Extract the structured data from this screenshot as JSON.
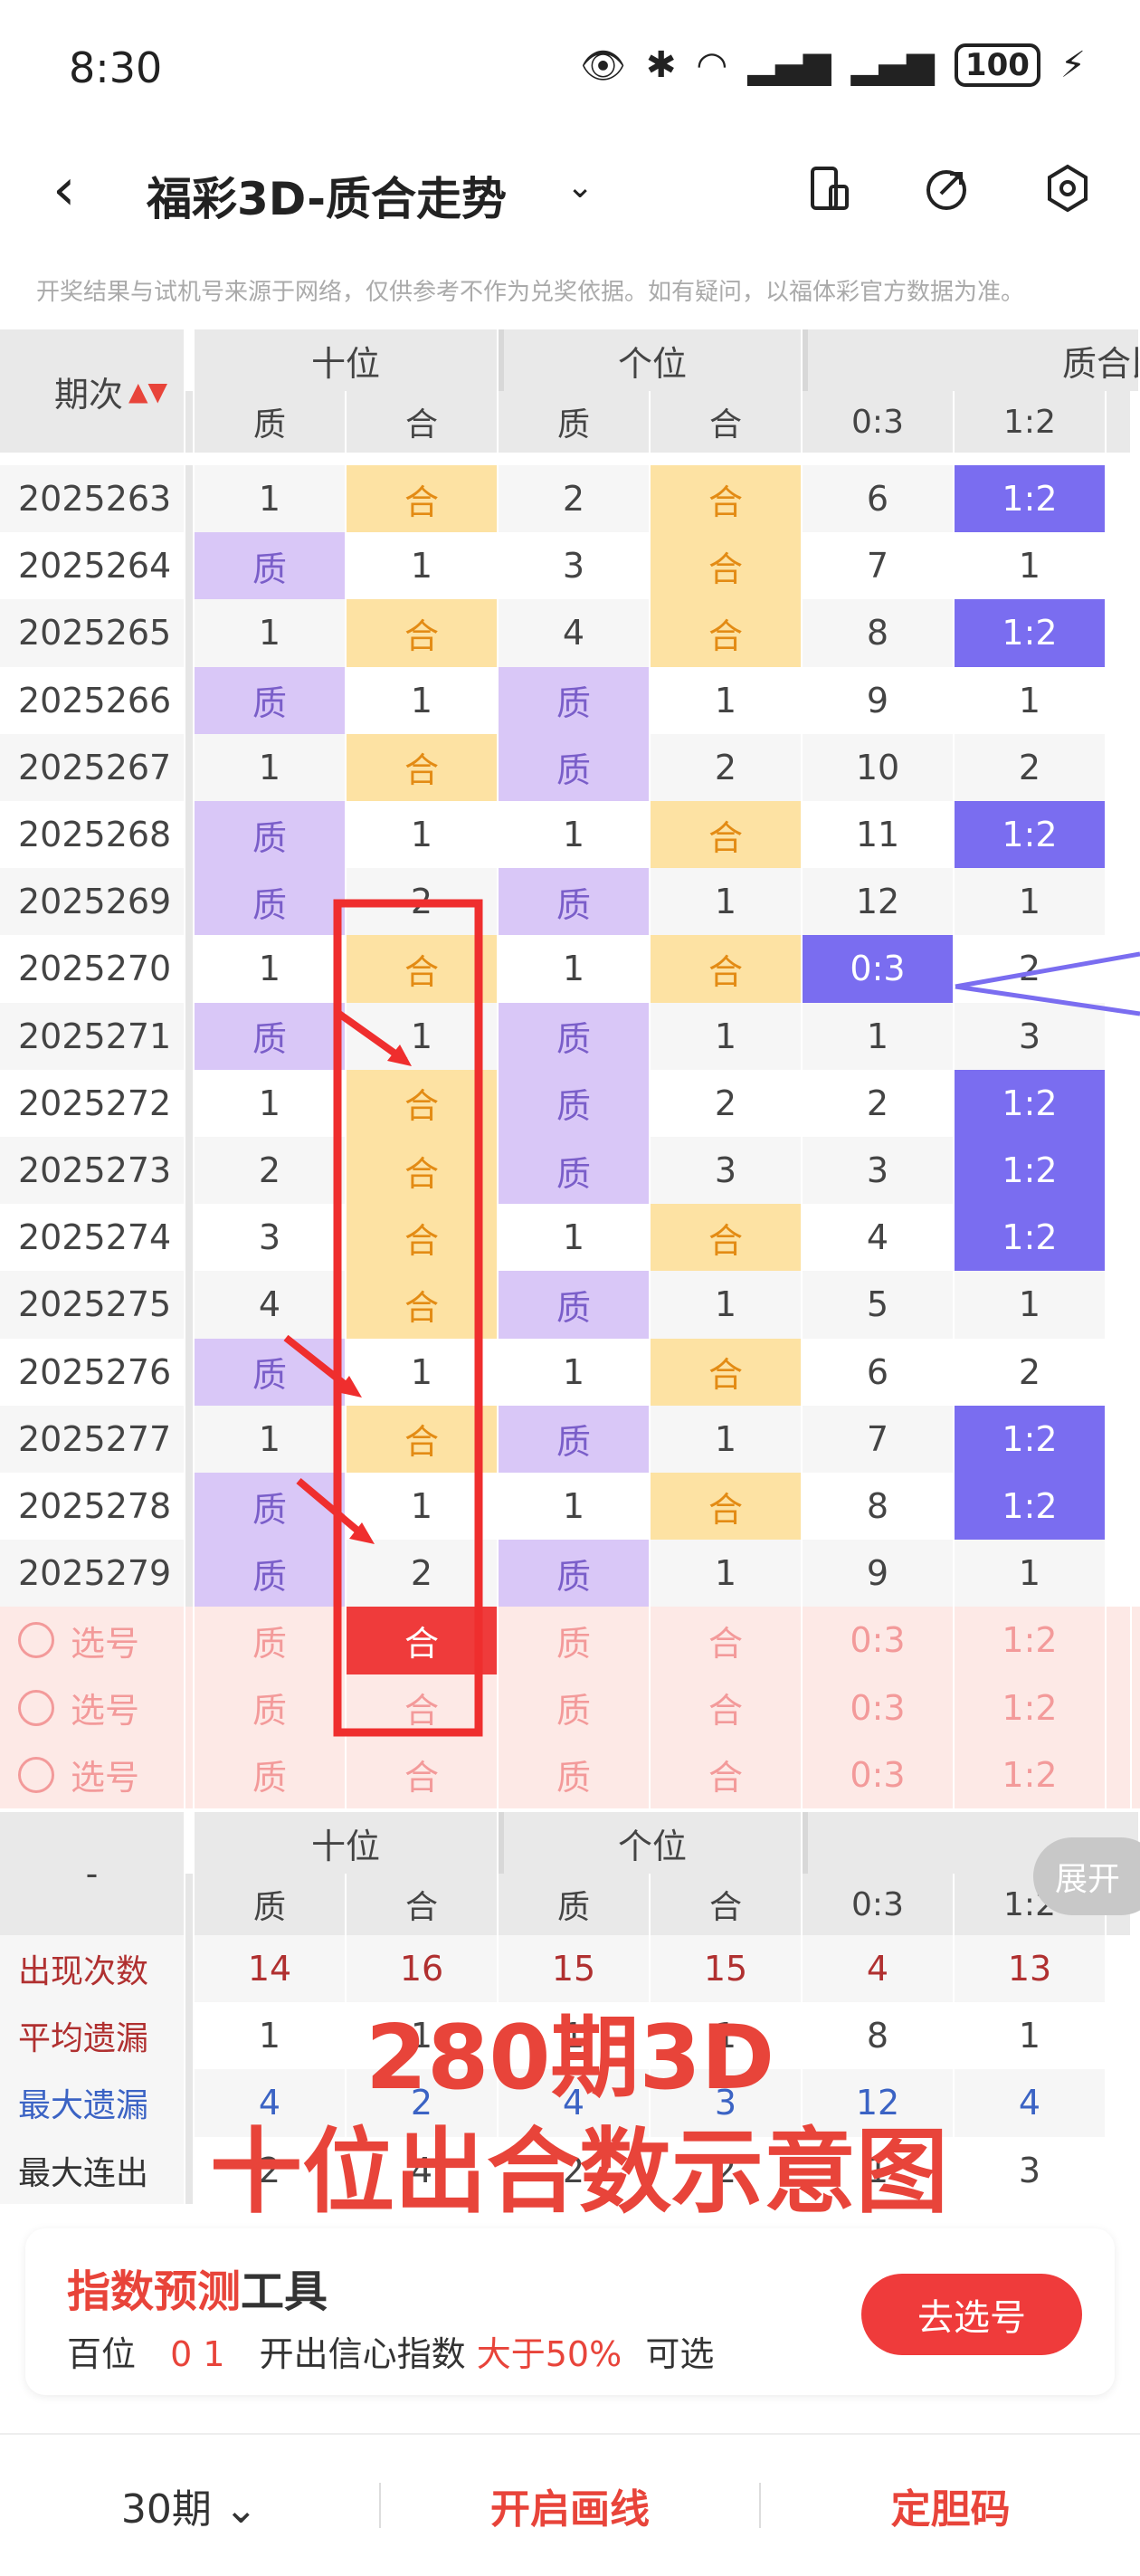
{
  "status": {
    "time": "8:30",
    "battery": "100"
  },
  "header": {
    "title": "福彩3D-质合走势"
  },
  "notice": "开奖结果与试机号来源于网络，仅供参考不作为兑奖依据。如有疑问，以福体彩官方数据为准。",
  "table": {
    "col_period": "期次",
    "group_shi": "十位",
    "group_ge": "个位",
    "group_ratio": "质合比",
    "sub_zhi": "质",
    "sub_he": "合",
    "ratio_03": "0:3",
    "ratio_12": "1:2",
    "rows": [
      {
        "period": "2025263",
        "shi_zhi": "1",
        "shi_he": "合",
        "ge_zhi": "2",
        "ge_he": "合",
        "r03": "6",
        "r12": "1:2"
      },
      {
        "period": "2025264",
        "shi_zhi": "质",
        "shi_he": "1",
        "ge_zhi": "3",
        "ge_he": "合",
        "r03": "7",
        "r12": "1"
      },
      {
        "period": "2025265",
        "shi_zhi": "1",
        "shi_he": "合",
        "ge_zhi": "4",
        "ge_he": "合",
        "r03": "8",
        "r12": "1:2"
      },
      {
        "period": "2025266",
        "shi_zhi": "质",
        "shi_he": "1",
        "ge_zhi": "质",
        "ge_he": "1",
        "r03": "9",
        "r12": "1"
      },
      {
        "period": "2025267",
        "shi_zhi": "1",
        "shi_he": "合",
        "ge_zhi": "质",
        "ge_he": "2",
        "r03": "10",
        "r12": "2"
      },
      {
        "period": "2025268",
        "shi_zhi": "质",
        "shi_he": "1",
        "ge_zhi": "1",
        "ge_he": "合",
        "r03": "11",
        "r12": "1:2"
      },
      {
        "period": "2025269",
        "shi_zhi": "质",
        "shi_he": "2",
        "ge_zhi": "质",
        "ge_he": "1",
        "r03": "12",
        "r12": "1"
      },
      {
        "period": "2025270",
        "shi_zhi": "1",
        "shi_he": "合",
        "ge_zhi": "1",
        "ge_he": "合",
        "r03": "0:3",
        "r12": "2"
      },
      {
        "period": "2025271",
        "shi_zhi": "质",
        "shi_he": "1",
        "ge_zhi": "质",
        "ge_he": "1",
        "r03": "1",
        "r12": "3"
      },
      {
        "period": "2025272",
        "shi_zhi": "1",
        "shi_he": "合",
        "ge_zhi": "质",
        "ge_he": "2",
        "r03": "2",
        "r12": "1:2"
      },
      {
        "period": "2025273",
        "shi_zhi": "2",
        "shi_he": "合",
        "ge_zhi": "质",
        "ge_he": "3",
        "r03": "3",
        "r12": "1:2"
      },
      {
        "period": "2025274",
        "shi_zhi": "3",
        "shi_he": "合",
        "ge_zhi": "1",
        "ge_he": "合",
        "r03": "4",
        "r12": "1:2"
      },
      {
        "period": "2025275",
        "shi_zhi": "4",
        "shi_he": "合",
        "ge_zhi": "质",
        "ge_he": "1",
        "r03": "5",
        "r12": "1"
      },
      {
        "period": "2025276",
        "shi_zhi": "质",
        "shi_he": "1",
        "ge_zhi": "1",
        "ge_he": "合",
        "r03": "6",
        "r12": "2"
      },
      {
        "period": "2025277",
        "shi_zhi": "1",
        "shi_he": "合",
        "ge_zhi": "质",
        "ge_he": "1",
        "r03": "7",
        "r12": "1:2"
      },
      {
        "period": "2025278",
        "shi_zhi": "质",
        "shi_he": "1",
        "ge_zhi": "1",
        "ge_he": "合",
        "r03": "8",
        "r12": "1:2"
      },
      {
        "period": "2025279",
        "shi_zhi": "质",
        "shi_he": "2",
        "ge_zhi": "质",
        "ge_he": "1",
        "r03": "9",
        "r12": "1"
      }
    ],
    "select_label": "选号",
    "select_rows": [
      {
        "shi_zhi": "质",
        "shi_he": "合",
        "ge_zhi": "质",
        "ge_he": "合",
        "r03": "0:3",
        "r12": "1:2"
      },
      {
        "shi_zhi": "质",
        "shi_he": "合",
        "ge_zhi": "质",
        "ge_he": "合",
        "r03": "0:3",
        "r12": "1:2"
      },
      {
        "shi_zhi": "质",
        "shi_he": "合",
        "ge_zhi": "质",
        "ge_he": "合",
        "r03": "0:3",
        "r12": "1:2"
      }
    ],
    "summary_dash": "-",
    "expand_label": "展开",
    "stats": [
      {
        "label": "出现次数",
        "vals": [
          "14",
          "16",
          "15",
          "15",
          "4",
          "13"
        ]
      },
      {
        "label": "平均遗漏",
        "vals": [
          "1",
          "1",
          "1",
          "1",
          "8",
          "1"
        ]
      },
      {
        "label": "最大遗漏",
        "vals": [
          "4",
          "2",
          "4",
          "3",
          "12",
          "4"
        ]
      },
      {
        "label": "最大连出",
        "vals": [
          "2",
          "4",
          "2",
          "2",
          "1",
          "3"
        ]
      }
    ]
  },
  "annotation": {
    "line1": "280期3D",
    "line2": "十位出合数示意图"
  },
  "tool": {
    "title_red": "指数预测",
    "title_black": "工具",
    "desc_a": "百位",
    "desc_nums": "0 1",
    "desc_b": "开出信心指数",
    "desc_red": "大于50%",
    "desc_c": "可选",
    "button": "去选号"
  },
  "bottom": {
    "periods": "30期",
    "draw_line": "开启画线",
    "dingdan": "定胆码"
  },
  "colors": {
    "accent": "#e8443a",
    "zhi": "#d9c7f7",
    "he": "#fde2a3",
    "ratio": "#7a6df0"
  }
}
